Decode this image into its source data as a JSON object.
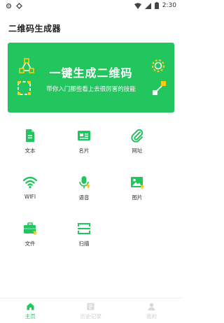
{
  "status_bar": {
    "time": "2:30"
  },
  "header": {
    "title": "二维码生成器"
  },
  "banner": {
    "title": "一键生成二维码",
    "subtitle": "带你入门那些看上去很厉害的技能"
  },
  "colors": {
    "accent": "#22c55e",
    "icon_yellow": "#facc15",
    "inactive": "#cfcfcf"
  },
  "grid": [
    {
      "label": "文本",
      "icon": "document-icon"
    },
    {
      "label": "名片",
      "icon": "business-card-icon"
    },
    {
      "label": "网址",
      "icon": "paperclip-icon"
    },
    {
      "label": "WIFI",
      "icon": "wifi-icon"
    },
    {
      "label": "语音",
      "icon": "microphone-icon"
    },
    {
      "label": "图片",
      "icon": "image-icon"
    },
    {
      "label": "文件",
      "icon": "briefcase-icon"
    },
    {
      "label": "扫描",
      "icon": "scan-icon"
    }
  ],
  "bottom_nav": [
    {
      "label": "主页",
      "icon": "home-icon",
      "active": true
    },
    {
      "label": "历史记录",
      "icon": "history-icon",
      "active": false
    },
    {
      "label": "我的",
      "icon": "profile-icon",
      "active": false
    }
  ]
}
